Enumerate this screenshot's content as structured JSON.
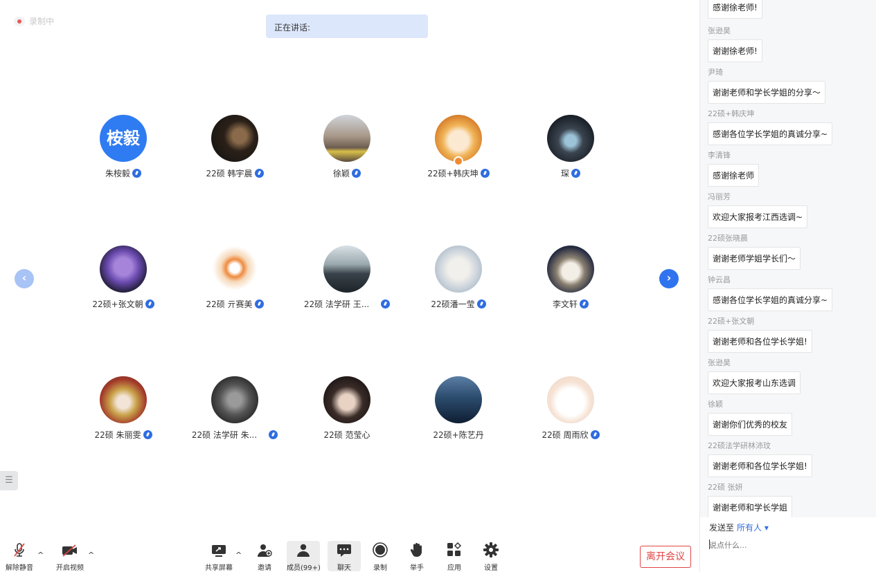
{
  "recording": {
    "label": "录制中"
  },
  "speaking": {
    "label": "正在讲话:"
  },
  "participants": [
    {
      "name": "朱桉毅",
      "avatar_text": "桉毅",
      "mic": true
    },
    {
      "name": "22硕 韩宇晨",
      "mic": true
    },
    {
      "name": "徐颖",
      "mic": true
    },
    {
      "name": "22硕+韩庆坤",
      "mic": true,
      "host": true
    },
    {
      "name": "琛",
      "mic": true
    },
    {
      "name": "22硕+张文朝",
      "mic": true
    },
    {
      "name": "22硕 亓赛美",
      "mic": true
    },
    {
      "name": "22硕 法学研 王...",
      "mic": true
    },
    {
      "name": "22硕潘一莹",
      "mic": true
    },
    {
      "name": "李文轩",
      "mic": true
    },
    {
      "name": "22硕 朱丽雯",
      "mic": true
    },
    {
      "name": "22硕 法学研 朱...",
      "mic": true
    },
    {
      "name": "22硕 范莹心",
      "mic": false
    },
    {
      "name": "22硕+陈艺丹",
      "mic": false
    },
    {
      "name": "22硕 周雨欣",
      "mic": true
    }
  ],
  "nav": {
    "prev": "‹",
    "next": "›"
  },
  "toolbar": {
    "unmute": "解除静音",
    "video": "开启视频",
    "share": "共享屏幕",
    "invite": "邀请",
    "members": "成员(99+)",
    "chat": "聊天",
    "record": "录制",
    "raise_hand": "举手",
    "apps": "应用",
    "settings": "设置",
    "leave": "离开会议"
  },
  "chat": {
    "messages": [
      {
        "name": "",
        "text": "感谢徐老师!"
      },
      {
        "name": "张逊昊",
        "text": "谢谢徐老师!"
      },
      {
        "name": "尹琦",
        "text": "谢谢老师和学长学姐的分享～"
      },
      {
        "name": "22硕+韩庆坤",
        "text": "感谢各位学长学姐的真诚分享~"
      },
      {
        "name": "李清锋",
        "text": "感谢徐老师"
      },
      {
        "name": "冯丽芳",
        "text": "欢迎大家报考江西选调~"
      },
      {
        "name": "22硕张晓晨",
        "text": "谢谢老师学姐学长们～"
      },
      {
        "name": "钟云昌",
        "text": "感谢各位学长学姐的真诚分享~"
      },
      {
        "name": "22硕+张文朝",
        "text": "谢谢老师和各位学长学姐!"
      },
      {
        "name": "张逊昊",
        "text": "欢迎大家报考山东选调"
      },
      {
        "name": "徐颖",
        "text": "谢谢你们优秀的校友"
      },
      {
        "name": "22硕法学研林沛玟",
        "text": "谢谢老师和各位学长学姐!"
      },
      {
        "name": "22硕 张妍",
        "text": "谢谢老师和学长学姐"
      }
    ],
    "send_to_label": "发送至",
    "send_to_target": "所有人 ▾",
    "placeholder": "说点什么..."
  },
  "colors": {
    "accent": "#2f73ee",
    "leave": "#e04444",
    "speaking_bg": "#dce7fb"
  }
}
